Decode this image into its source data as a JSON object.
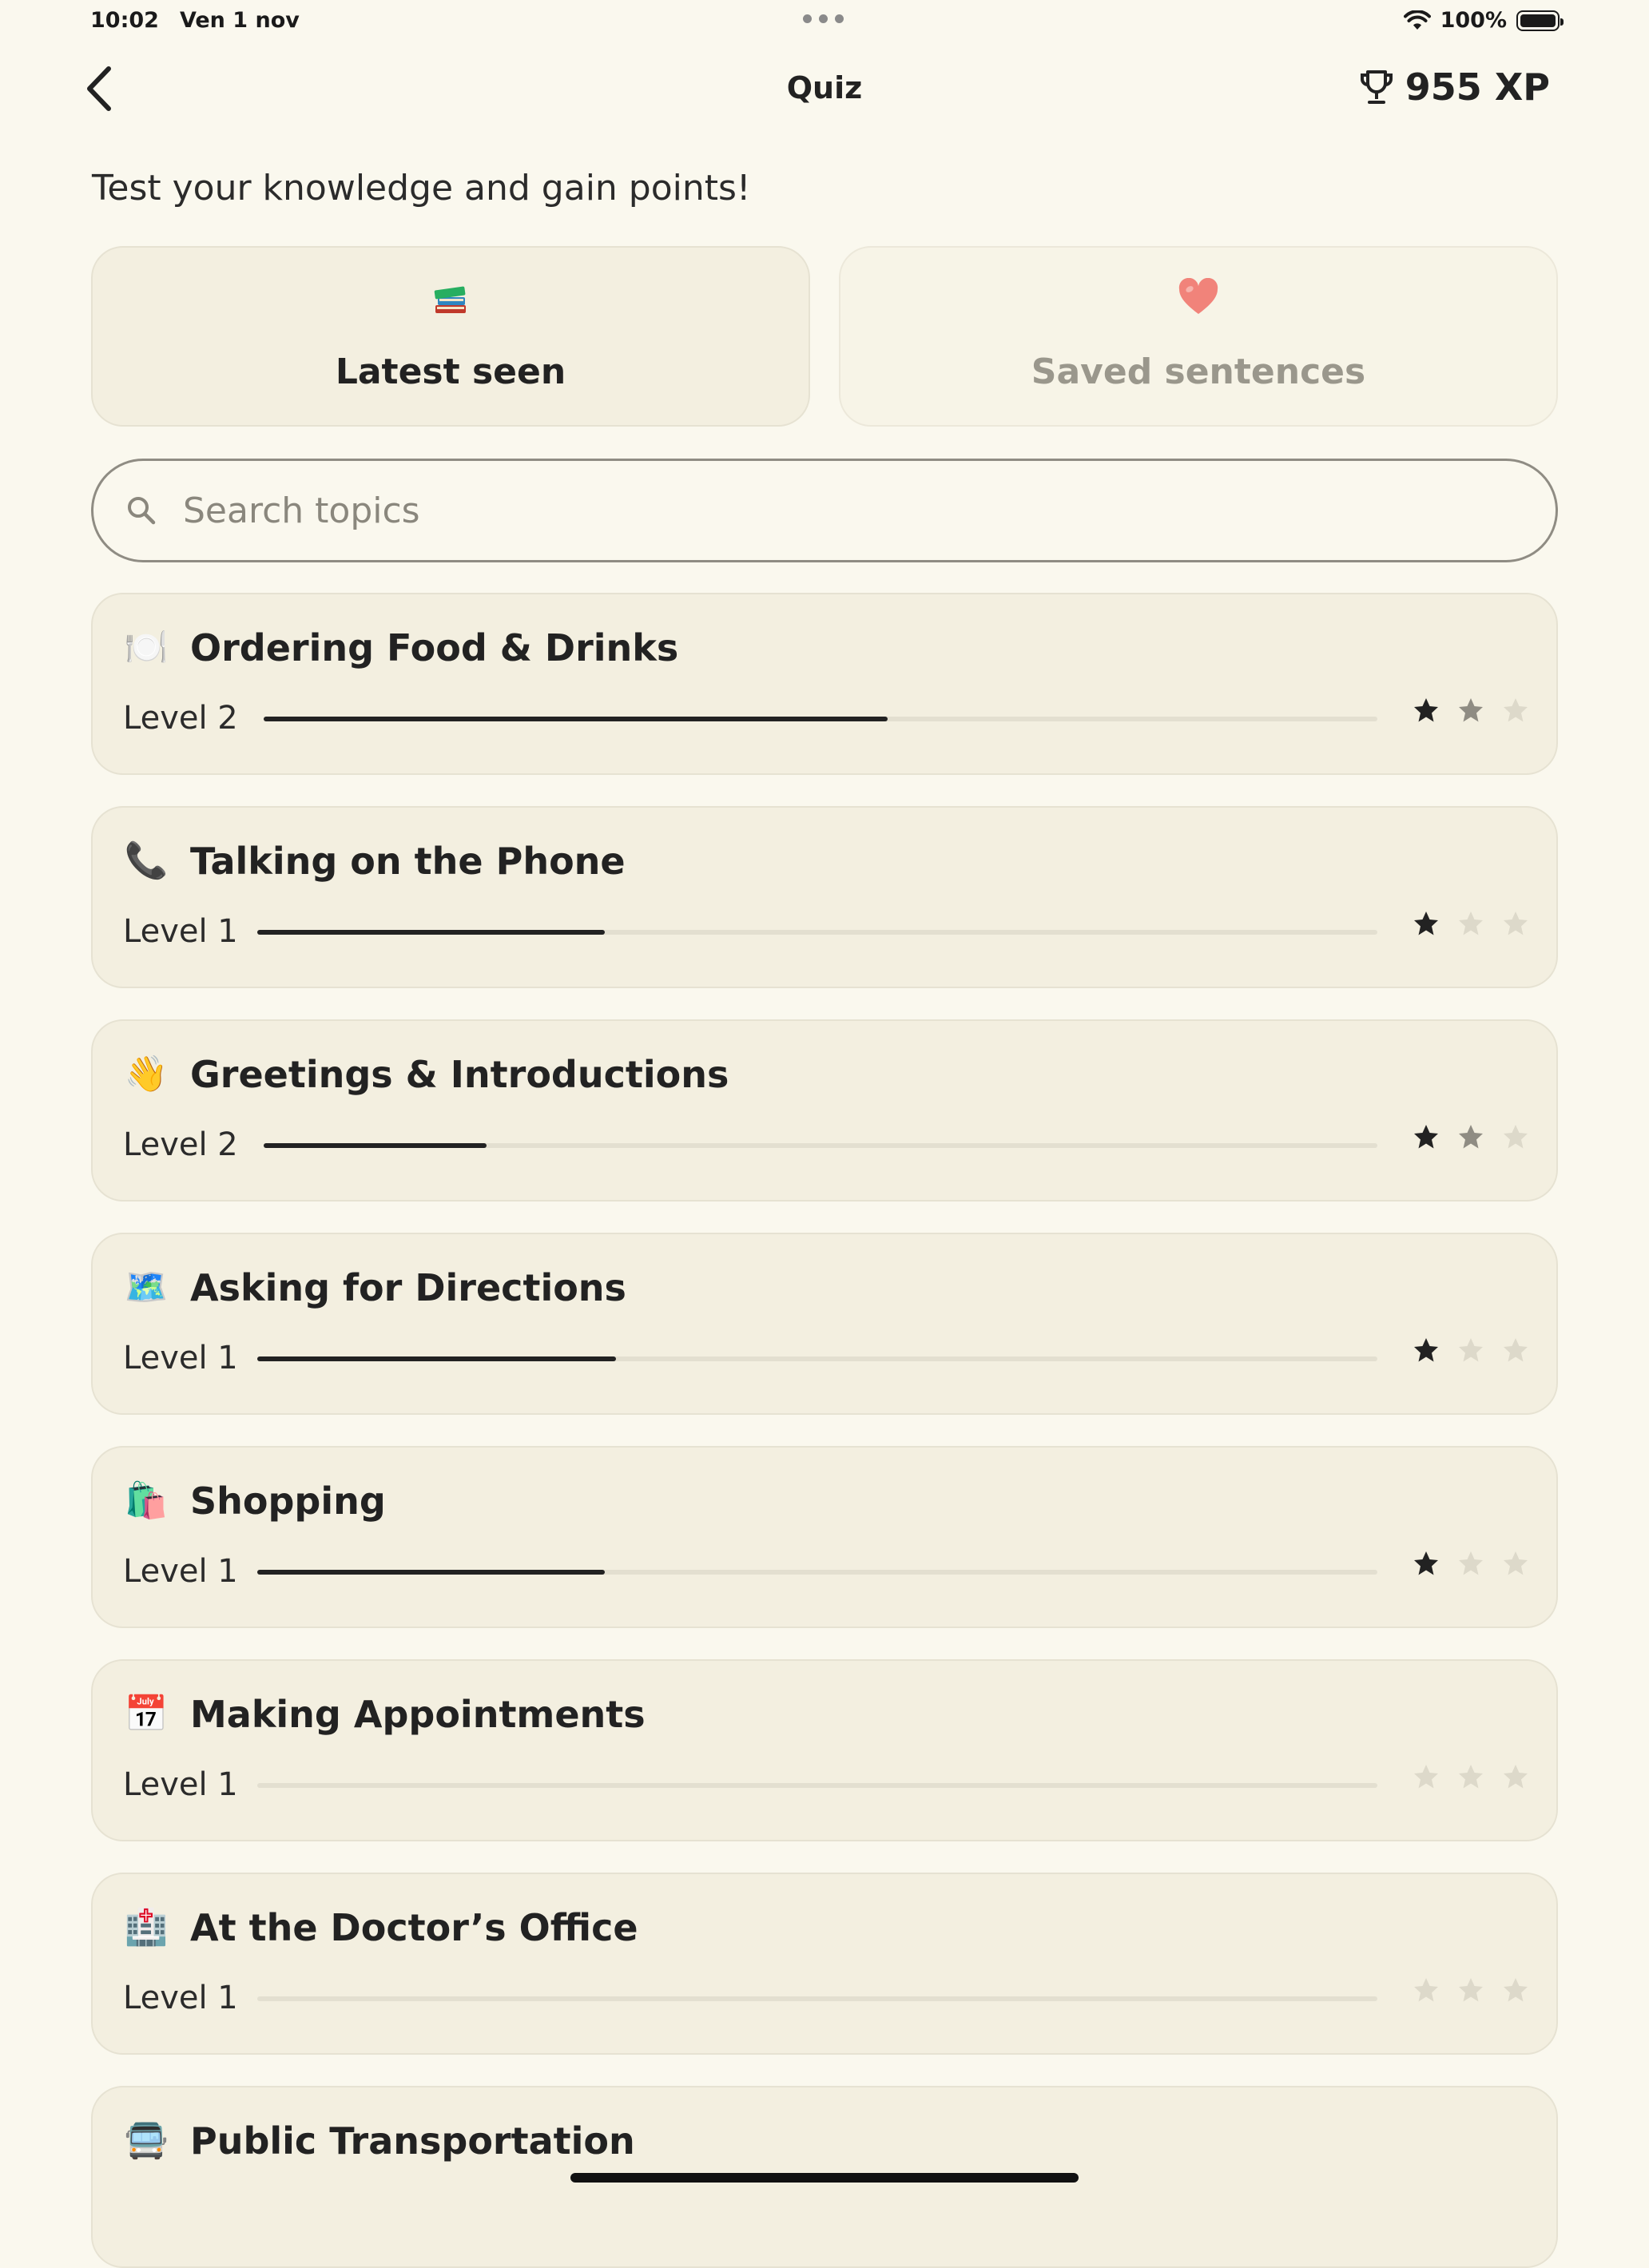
{
  "status_bar": {
    "time": "10:02",
    "date": "Ven 1 nov",
    "battery": "100%"
  },
  "header": {
    "title": "Quiz",
    "xp": "955 XP"
  },
  "subtitle": "Test your knowledge and gain points!",
  "tiles": [
    {
      "label": "Latest seen",
      "icon": "books-icon",
      "emoji": "📚",
      "selected": true
    },
    {
      "label": "Saved sentences",
      "icon": "heart-icon",
      "emoji": "❤️",
      "selected": false
    }
  ],
  "search": {
    "placeholder": "Search topics",
    "value": ""
  },
  "topics": [
    {
      "title": "Ordering Food & Drinks",
      "emoji": "🍽️",
      "icon": "plate-icon",
      "level": "Level 2",
      "progress": 0.56,
      "stars": 2
    },
    {
      "title": "Talking on the Phone",
      "emoji": "📞",
      "icon": "phone-icon",
      "level": "Level 1",
      "progress": 0.31,
      "stars": 1
    },
    {
      "title": "Greetings & Introductions",
      "emoji": "👋",
      "icon": "wave-icon",
      "level": "Level 2",
      "progress": 0.2,
      "stars": 2
    },
    {
      "title": "Asking for Directions",
      "emoji": "🗺️",
      "icon": "map-icon",
      "level": "Level 1",
      "progress": 0.32,
      "stars": 1
    },
    {
      "title": "Shopping",
      "emoji": "🛍️",
      "icon": "shopping-bags-icon",
      "level": "Level 1",
      "progress": 0.31,
      "stars": 1
    },
    {
      "title": "Making Appointments",
      "emoji": "📅",
      "icon": "calendar-icon",
      "level": "Level 1",
      "progress": 0,
      "stars": 0
    },
    {
      "title": "At the Doctor’s Office",
      "emoji": "🏥",
      "icon": "hospital-icon",
      "level": "Level 1",
      "progress": 0,
      "stars": 0
    },
    {
      "title": "Public Transportation",
      "emoji": "🚍",
      "icon": "bus-icon",
      "level": "",
      "progress": null,
      "stars": null
    }
  ],
  "colors": {
    "background": "#FAF8EE",
    "card": "#F3EFE0",
    "progress_fill": "#222222",
    "progress_track": "#E3DFD0",
    "star_filled": "#222222",
    "star_partial": "#8F8C83",
    "star_empty": "#DDD9CA"
  }
}
